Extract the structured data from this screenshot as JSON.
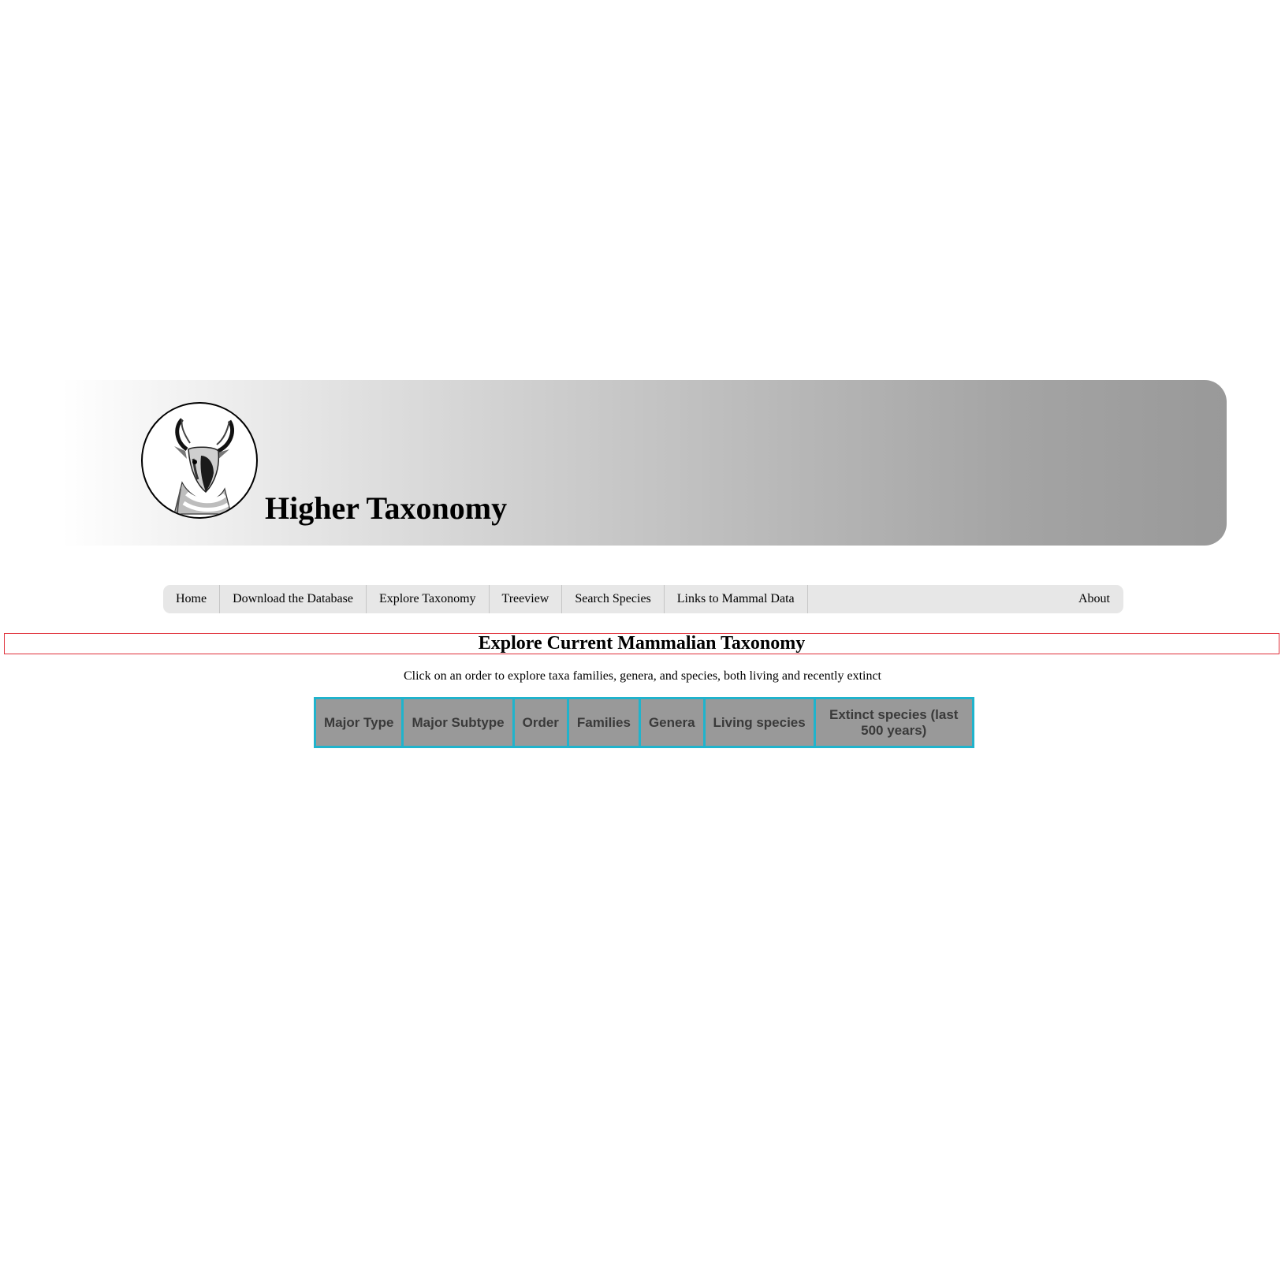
{
  "header": {
    "title": "Higher Taxonomy",
    "logo_icon": "pronghorn-antelope-icon"
  },
  "nav": {
    "items": [
      {
        "label": "Home"
      },
      {
        "label": "Download the Database"
      },
      {
        "label": "Explore Taxonomy"
      },
      {
        "label": "Treeview"
      },
      {
        "label": "Search Species"
      },
      {
        "label": "Links to Mammal Data"
      }
    ],
    "about": "About"
  },
  "main": {
    "heading": "Explore Current Mammalian Taxonomy",
    "subtitle": "Click on an order to explore taxa families, genera, and species, both living and recently extinct",
    "table": {
      "columns": [
        "Major Type",
        "Major Subtype",
        "Order",
        "Families",
        "Genera",
        "Living species",
        "Extinct species (last 500 years)"
      ]
    }
  },
  "colors": {
    "table_border": "#20b3cc",
    "table_header_bg": "#999999",
    "heading_box_border": "#e0303a",
    "nav_bg": "#e7e7e7"
  }
}
